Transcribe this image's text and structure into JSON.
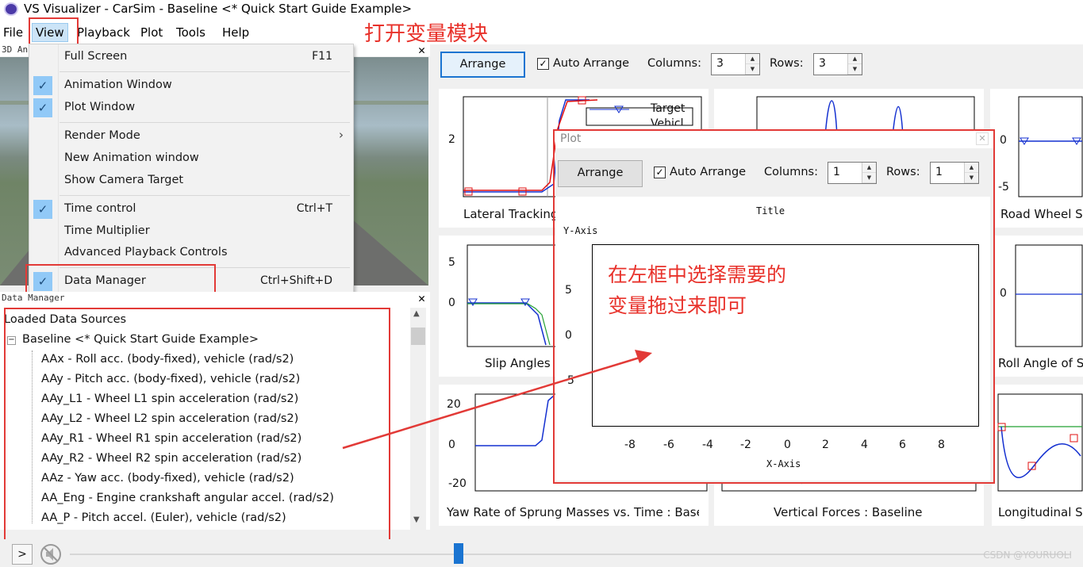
{
  "window": {
    "title": "VS Visualizer - CarSim - Baseline <* Quick Start Guide Example>"
  },
  "menubar": {
    "items": [
      "File",
      "View",
      "Playback",
      "Plot",
      "Tools",
      "Help"
    ]
  },
  "annotations": {
    "open_variable_module": "打开变量模块",
    "drag_hint_line1": "在左框中选择需要的",
    "drag_hint_line2": "变量拖过来即可",
    "accent_color": "#e23a37"
  },
  "view_menu": {
    "items": [
      {
        "label": "Full Screen",
        "shortcut": "F11",
        "checked": false
      },
      {
        "label": "Animation Window",
        "shortcut": "",
        "checked": true
      },
      {
        "label": "Plot Window",
        "shortcut": "",
        "checked": true
      },
      {
        "label": "Render Mode",
        "shortcut": "",
        "checked": false,
        "submenu": true
      },
      {
        "label": "New Animation window",
        "shortcut": "",
        "checked": false
      },
      {
        "label": "Show Camera Target",
        "shortcut": "",
        "checked": false
      },
      {
        "label": "Time control",
        "shortcut": "Ctrl+T",
        "checked": true
      },
      {
        "label": "Time Multiplier",
        "shortcut": "",
        "checked": false
      },
      {
        "label": "Advanced Playback Controls",
        "shortcut": "",
        "checked": false
      },
      {
        "label": "Data Manager",
        "shortcut": "Ctrl+Shift+D",
        "checked": true
      }
    ]
  },
  "panel_3d": {
    "title": "3D An"
  },
  "data_manager": {
    "title": "Data Manager",
    "root": "Loaded Data Sources",
    "dataset": "Baseline <* Quick Start Guide Example>",
    "variables": [
      "AAx - Roll acc. (body-fixed), vehicle (rad/s2)",
      "AAy - Pitch acc. (body-fixed), vehicle (rad/s2)",
      "AAy_L1 - Wheel L1 spin acceleration (rad/s2)",
      "AAy_L2 - Wheel L2 spin acceleration (rad/s2)",
      "AAy_R1 - Wheel R1 spin acceleration (rad/s2)",
      "AAy_R2 - Wheel R2 spin acceleration (rad/s2)",
      "AAz - Yaw acc. (body-fixed), vehicle (rad/s2)",
      "AA_Eng - Engine crankshaft angular accel. (rad/s2)",
      "AA_P - Pitch accel. (Euler), vehicle (rad/s2)"
    ]
  },
  "plot_toolbar": {
    "arrange_label": "Arrange",
    "auto_arrange_label": "Auto Arrange",
    "columns_label": "Columns:",
    "columns_value": "3",
    "rows_label": "Rows:",
    "rows_value": "3"
  },
  "tiles": [
    {
      "caption": "Lateral Tracking",
      "ticks": [
        "2"
      ],
      "legend": [
        "Target",
        "Vehicl"
      ]
    },
    {
      "caption": "Road Wheel S",
      "ticks": [
        "0",
        "-5"
      ]
    },
    {
      "caption": "Slip Angles",
      "ticks": [
        "5",
        "0"
      ]
    },
    {
      "caption": "Roll Angle of S",
      "ticks": [
        "0"
      ]
    },
    {
      "caption": "Yaw Rate of Sprung Masses vs. Time : Base",
      "ticks": [
        "20",
        "0",
        "-20"
      ]
    },
    {
      "caption": "Vertical Forces : Baseline",
      "ticks": []
    },
    {
      "caption": "Longitudinal Sp",
      "ticks": []
    }
  ],
  "plot_window": {
    "title": "Plot",
    "arrange_label": "Arrange",
    "auto_arrange_label": "Auto Arrange",
    "columns_label": "Columns:",
    "columns_value": "1",
    "rows_label": "Rows:",
    "rows_value": "1",
    "chart_title": "Title",
    "y_axis_label": "Y-Axis",
    "x_axis_label": "X-Axis",
    "y_ticks": [
      "5",
      "0",
      "-5"
    ],
    "x_ticks": [
      "-8",
      "-6",
      "-4",
      "-2",
      "0",
      "2",
      "4",
      "6",
      "8"
    ]
  },
  "chart_data": {
    "type": "line",
    "title": "Title",
    "xlabel": "X-Axis",
    "ylabel": "Y-Axis",
    "xlim": [
      -9,
      9
    ],
    "ylim": [
      -8,
      8
    ],
    "series": []
  },
  "bottom_bar": {
    "play_label": ">",
    "watermark": "CSDN @YOURUOLI"
  }
}
